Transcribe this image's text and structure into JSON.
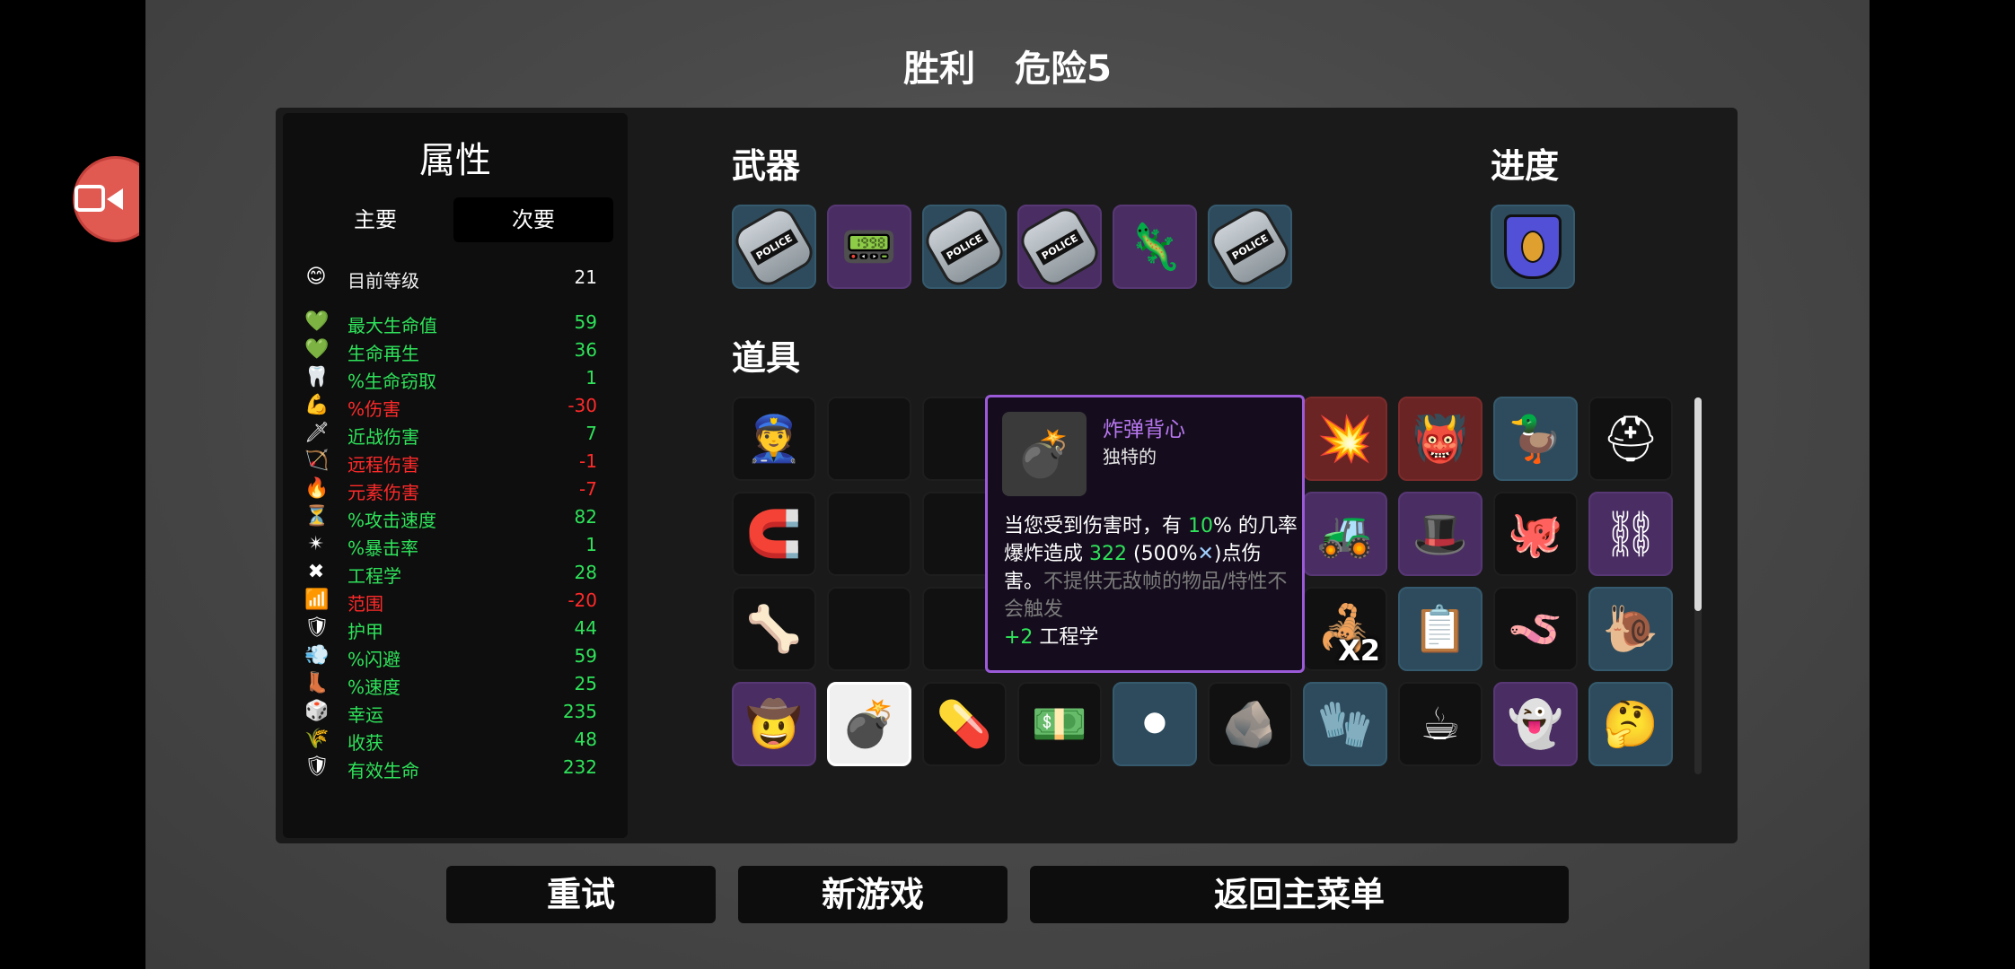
{
  "header": {
    "result": "胜利",
    "danger": "危险5"
  },
  "stats": {
    "title": "属性",
    "tabs": {
      "primary": "主要",
      "secondary": "次要"
    },
    "level": {
      "label": "目前等级",
      "value": "21",
      "icon": "emoji-face-icon"
    },
    "rows": [
      {
        "label": "最大生命值",
        "value": "59",
        "color": "green",
        "icon": "heart-icon",
        "glyph": "💚"
      },
      {
        "label": "生命再生",
        "value": "36",
        "color": "green",
        "icon": "heart-plus-icon",
        "glyph": "💚"
      },
      {
        "label": "%生命窃取",
        "value": "1",
        "color": "green",
        "icon": "fangs-icon",
        "glyph": "🦷"
      },
      {
        "label": "%伤害",
        "value": "-30",
        "color": "red",
        "icon": "muscle-icon",
        "glyph": "💪"
      },
      {
        "label": "近战伤害",
        "value": "7",
        "color": "green",
        "icon": "sword-icon",
        "glyph": "🗡"
      },
      {
        "label": "远程伤害",
        "value": "-1",
        "color": "red",
        "icon": "bow-icon",
        "glyph": "🏹"
      },
      {
        "label": "元素伤害",
        "value": "-7",
        "color": "red",
        "icon": "flame-icon",
        "glyph": "🔥"
      },
      {
        "label": "%攻击速度",
        "value": "82",
        "color": "green",
        "icon": "hourglass-icon",
        "glyph": "⏳"
      },
      {
        "label": "%暴击率",
        "value": "1",
        "color": "green",
        "icon": "crit-icon",
        "glyph": "✴"
      },
      {
        "label": "工程学",
        "value": "28",
        "color": "green",
        "icon": "wrench-cross-icon",
        "glyph": "✖"
      },
      {
        "label": "范围",
        "value": "-20",
        "color": "red",
        "icon": "range-icon",
        "glyph": "📶"
      },
      {
        "label": "护甲",
        "value": "44",
        "color": "green",
        "icon": "shield-icon",
        "glyph": "🛡"
      },
      {
        "label": "%闪避",
        "value": "59",
        "color": "green",
        "icon": "dodge-icon",
        "glyph": "💨"
      },
      {
        "label": "%速度",
        "value": "25",
        "color": "green",
        "icon": "boot-icon",
        "glyph": "👢"
      },
      {
        "label": "幸运",
        "value": "235",
        "color": "green",
        "icon": "dice-icon",
        "glyph": "🎲"
      },
      {
        "label": "收获",
        "value": "48",
        "color": "green",
        "icon": "wheat-icon",
        "glyph": "🌾"
      },
      {
        "label": "有效生命",
        "value": "232",
        "color": "green",
        "icon": "shield-heart-icon",
        "glyph": "🛡"
      }
    ]
  },
  "weapons": {
    "title": "武器",
    "items": [
      {
        "icon": "riot-shield-icon",
        "bg": "blue",
        "text": "POLICE"
      },
      {
        "icon": "taser-icon",
        "bg": "purple",
        "glyph": "📟"
      },
      {
        "icon": "riot-shield-icon",
        "bg": "blue",
        "text": "POLICE"
      },
      {
        "icon": "riot-shield-icon",
        "bg": "purple",
        "text": "POLICE"
      },
      {
        "icon": "creature-weapon-icon",
        "bg": "purple",
        "glyph": "🦎"
      },
      {
        "icon": "riot-shield-icon",
        "bg": "blue",
        "text": "POLICE"
      }
    ]
  },
  "progress": {
    "title": "进度",
    "items": [
      {
        "icon": "police-badge-icon",
        "bg": "blue"
      }
    ]
  },
  "items": {
    "title": "道具",
    "rows": [
      [
        {
          "icon": "cop-face-icon",
          "bg": "black",
          "glyph": "👮"
        },
        {
          "icon": "hidden-item-icon",
          "bg": "black",
          "glyph": ""
        },
        {
          "icon": "hidden-item-icon",
          "bg": "black",
          "glyph": ""
        },
        {
          "icon": "hidden-item-icon",
          "bg": "black",
          "glyph": ""
        },
        {
          "icon": "teapot-icon",
          "bg": "blue",
          "glyph": "🫖"
        },
        {
          "icon": "rocket-icon",
          "bg": "blue",
          "glyph": "🚀"
        },
        {
          "icon": "explosion-icon",
          "bg": "red",
          "glyph": "💥"
        },
        {
          "icon": "demon-mask-icon",
          "bg": "red",
          "glyph": "👹"
        },
        {
          "icon": "duck-icon",
          "bg": "blue",
          "glyph": "🦆"
        },
        {
          "icon": "helmet-icon",
          "bg": "black",
          "glyph": "⛑"
        }
      ],
      [
        {
          "icon": "horseshoe-icon",
          "bg": "black",
          "glyph": "🧲"
        },
        {
          "icon": "hidden-item-icon",
          "bg": "black",
          "glyph": ""
        },
        {
          "icon": "hidden-item-icon",
          "bg": "black",
          "glyph": ""
        },
        {
          "icon": "hidden-item-icon",
          "bg": "black",
          "glyph": ""
        },
        {
          "icon": "skull-icon",
          "bg": "black",
          "glyph": "💀"
        },
        {
          "icon": "turret-icon",
          "bg": "purple",
          "glyph": "🤖"
        },
        {
          "icon": "bulldozer-icon",
          "bg": "purple",
          "glyph": "🚜"
        },
        {
          "icon": "bowler-hat-icon",
          "bg": "purple",
          "glyph": "🎩"
        },
        {
          "icon": "red-creature-icon",
          "bg": "black",
          "glyph": "🐙"
        },
        {
          "icon": "chain-totem-icon",
          "bg": "purple",
          "glyph": "⛓"
        }
      ],
      [
        {
          "icon": "ribs-icon",
          "bg": "black",
          "glyph": "🦴"
        },
        {
          "icon": "hidden-item-icon",
          "bg": "black",
          "glyph": ""
        },
        {
          "icon": "hidden-item-icon",
          "bg": "black",
          "glyph": ""
        },
        {
          "icon": "hidden-item-icon",
          "bg": "black",
          "glyph": ""
        },
        {
          "icon": "leaf-icon",
          "bg": "blue",
          "glyph": "🍃"
        },
        {
          "icon": "toolbox-icon",
          "bg": "purple",
          "glyph": "🧰"
        },
        {
          "icon": "drone-icon",
          "bg": "black",
          "glyph": "🦂",
          "count": "X2"
        },
        {
          "icon": "checklist-icon",
          "bg": "blue",
          "glyph": "📋"
        },
        {
          "icon": "worm-icon",
          "bg": "black",
          "glyph": "🪱"
        },
        {
          "icon": "snail-icon",
          "bg": "blue",
          "glyph": "🐌"
        }
      ],
      [
        {
          "icon": "cowboy-hat-icon",
          "bg": "purple",
          "glyph": "🤠"
        },
        {
          "icon": "bomb-vest-icon",
          "bg": "selected",
          "glyph": "💣"
        },
        {
          "icon": "pill-icon",
          "bg": "black",
          "glyph": "💊"
        },
        {
          "icon": "banknote-icon",
          "bg": "black",
          "glyph": "💵"
        },
        {
          "icon": "black-balls-icon",
          "bg": "blue",
          "glyph": "⚫"
        },
        {
          "icon": "rock-arrow-icon",
          "bg": "black",
          "glyph": "🪨"
        },
        {
          "icon": "glove-icon",
          "bg": "blue",
          "glyph": "🧤"
        },
        {
          "icon": "coffee-cup-icon",
          "bg": "black",
          "glyph": "☕"
        },
        {
          "icon": "purple-ghost-icon",
          "bg": "purple",
          "glyph": "👻"
        },
        {
          "icon": "confused-blob-icon",
          "bg": "blue",
          "glyph": "🤔"
        }
      ]
    ]
  },
  "tooltip": {
    "name": "炸弹背心",
    "rarity": "独特的",
    "icon": "bomb-vest-icon",
    "desc": {
      "p1": "当您受到伤害时，有 ",
      "pct": "10",
      "p2": "% 的几率爆炸造成 ",
      "dmg": "322",
      "p3": " (500%",
      "eng_symbol": "✕",
      "p4": ")点伤害。",
      "note": "不提供无敌帧的物品/特性不会触发",
      "bonus": "+2",
      "bonus_label": " 工程学"
    }
  },
  "buttons": {
    "retry": "重试",
    "new_game": "新游戏",
    "main_menu": "返回主菜单"
  },
  "overlay": {
    "record_icon": "video-record-icon"
  }
}
